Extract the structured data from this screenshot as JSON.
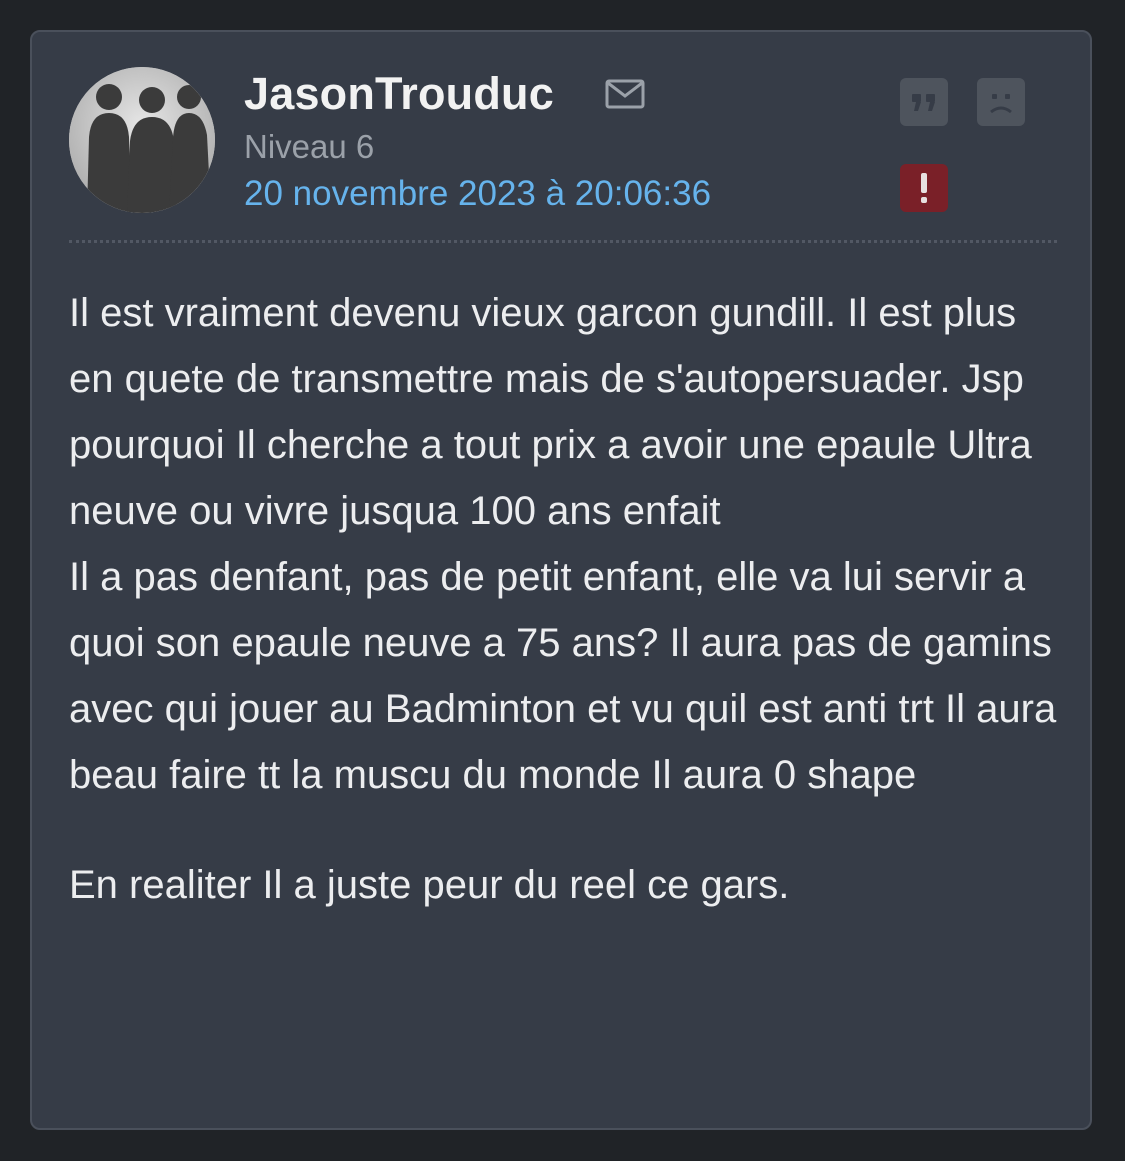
{
  "post": {
    "author": {
      "username": "JasonTrouduc",
      "level": "Niveau 6",
      "avatar_icon": "silhouettes-avatar"
    },
    "date": "20 novembre 2023 à 20:06:36",
    "icons": {
      "mail": "envelope-icon",
      "quote": "quote-icon",
      "sad": "sad-face-icon",
      "report": "exclamation-icon"
    },
    "body": {
      "paragraph_1": "Il est vraiment devenu vieux garcon gundill. Il est plus en quete de transmettre mais de s'autopersuader. Jsp pourquoi Il cherche a tout prix a avoir une epaule Ultra neuve ou vivre jusqua 100 ans enfait\nIl a pas denfant, pas de petit enfant, elle va lui servir a quoi son epaule neuve a 75 ans? Il aura pas de gamins avec qui jouer au Badminton et vu quil est anti trt Il aura beau faire tt la muscu du monde Il aura 0 shape",
      "paragraph_2": "En realiter Il a juste peur du reel ce gars."
    }
  },
  "colors": {
    "background": "#202327",
    "card": "#363c47",
    "username": "#f2f2f2",
    "level": "#9ba1a9",
    "date": "#66b3ec",
    "body_text": "#ecedef",
    "icon_button": "#4e545d",
    "report_button": "#7a2028"
  }
}
